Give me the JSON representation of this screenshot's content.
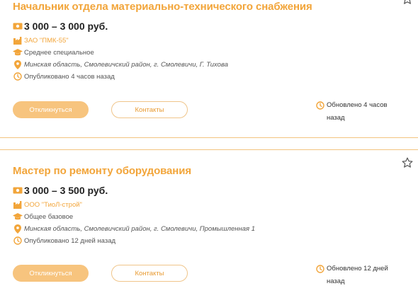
{
  "colors": {
    "accent": "#f2a53a",
    "button_fill": "#f7c47e",
    "separator": "#f3c47f"
  },
  "vacancies": [
    {
      "title": "Начальник отдела материально-технического снабжения",
      "salary": "3 000 – 3 000 руб.",
      "company": "ЗАО \"ПМК-55\"",
      "education": "Среднее специальное",
      "address": "Минская область, Смолевичский район, г. Смолевичи, Г. Тихова",
      "published": "Опубликовано 4 часов назад",
      "respond_label": "Откликнуться",
      "contacts_label": "Контакты",
      "updated_line1": "Обновлено 4 часов",
      "updated_line2": "назад",
      "icons": [
        "money-icon",
        "company-icon",
        "education-icon",
        "location-icon",
        "clock-icon",
        "star-icon"
      ]
    },
    {
      "title": "Мастер по ремонту оборудования",
      "salary": "3 000 – 3 500 руб.",
      "company": "ООО \"ТиоЛ-строй\"",
      "education": "Общее базовое",
      "address": "Минская область, Смолевичский район, г. Смолевичи, Промышленная 1",
      "published": "Опубликовано 12 дней назад",
      "respond_label": "Откликнуться",
      "contacts_label": "Контакты",
      "updated_line1": "Обновлено 12 дней",
      "updated_line2": "назад",
      "icons": [
        "money-icon",
        "company-icon",
        "education-icon",
        "location-icon",
        "clock-icon",
        "star-icon"
      ]
    }
  ]
}
